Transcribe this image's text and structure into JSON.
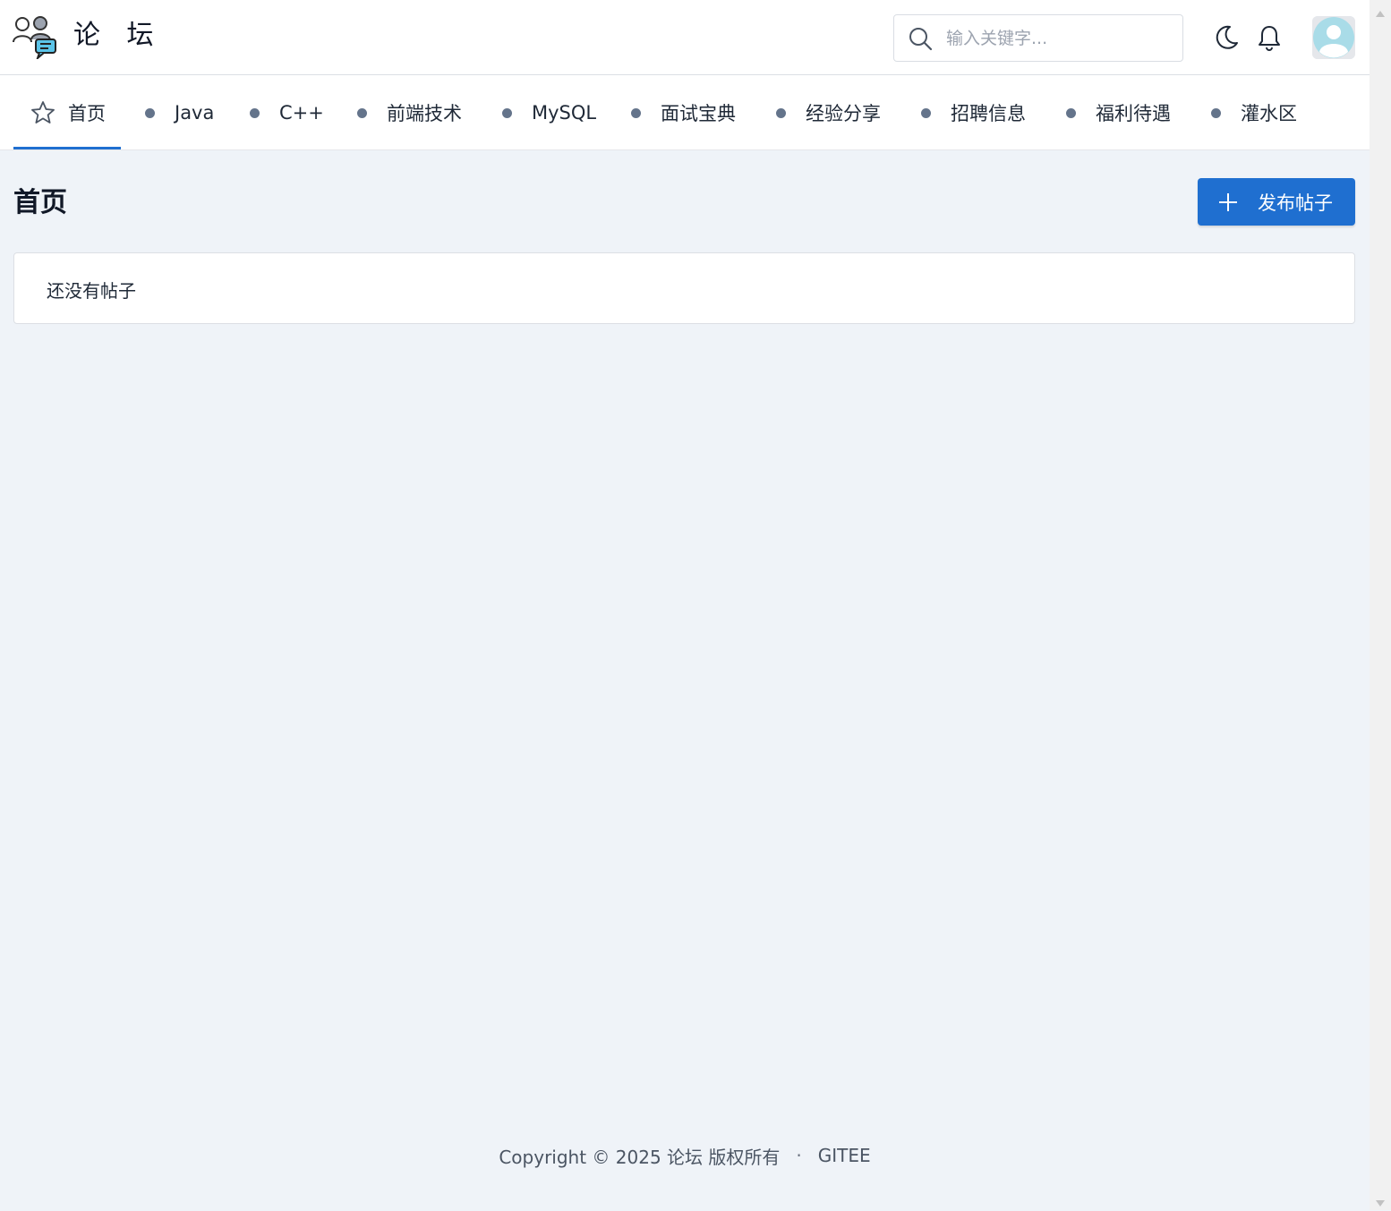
{
  "header": {
    "logo_text": "论 坛",
    "search_placeholder": "输入关键字..."
  },
  "nav": {
    "items": [
      {
        "label": "首页",
        "active": true,
        "icon": "star-icon"
      },
      {
        "label": "Java"
      },
      {
        "label": "C++"
      },
      {
        "label": "前端技术"
      },
      {
        "label": "MySQL"
      },
      {
        "label": "面试宝典"
      },
      {
        "label": "经验分享"
      },
      {
        "label": "招聘信息"
      },
      {
        "label": "福利待遇"
      },
      {
        "label": "灌水区"
      }
    ]
  },
  "main": {
    "title": "首页",
    "publish_button": "发布帖子",
    "empty_text": "还没有帖子"
  },
  "footer": {
    "copyright": "Copyright © 2025 论坛 版权所有",
    "separator": "·",
    "link": "GITEE"
  },
  "colors": {
    "accent": "#1f6fd0",
    "background": "#eff3f8",
    "dot": "#64748b"
  }
}
